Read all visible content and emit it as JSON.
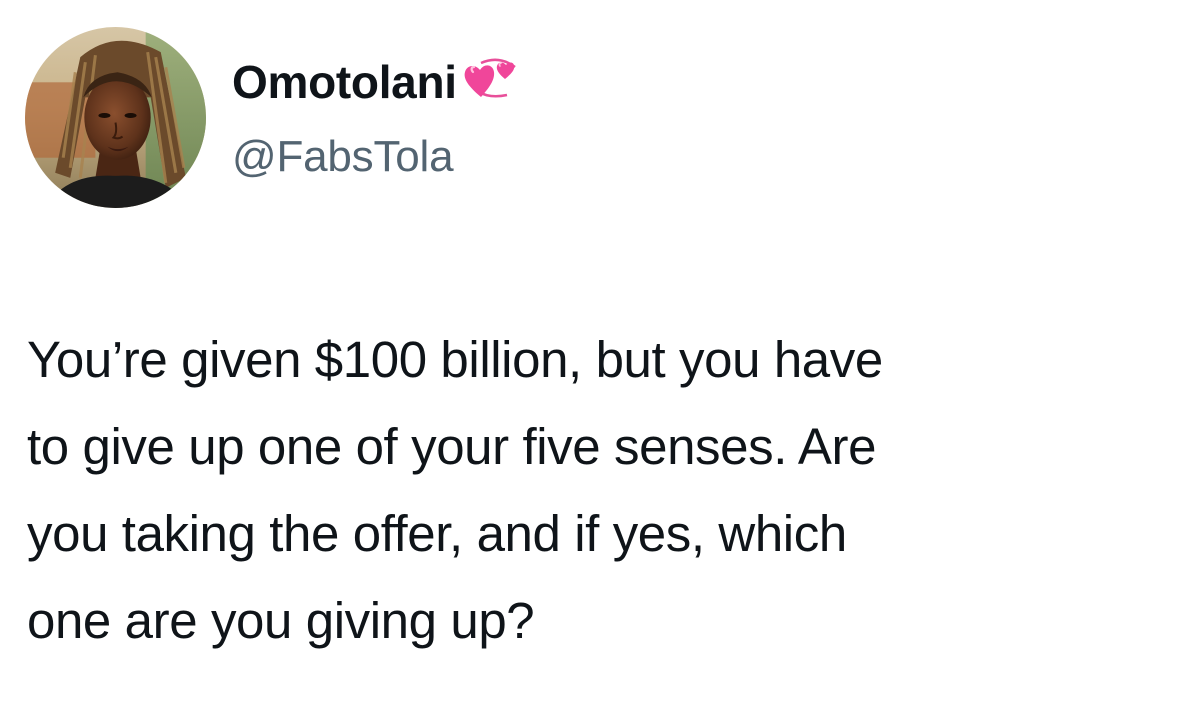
{
  "author": {
    "display_name": "Omotolani",
    "handle": "@FabsTola",
    "name_emoji": "revolving-hearts-icon"
  },
  "tweet": {
    "lines": [
      "You’re given $100 billion, but you have",
      "to give up one of your five senses. Are",
      "you taking the offer, and if yes, which",
      "one are you giving up?"
    ]
  },
  "colors": {
    "text": "#0f1419",
    "handle": "#536471",
    "heart": "#f0469a",
    "background": "#ffffff"
  }
}
